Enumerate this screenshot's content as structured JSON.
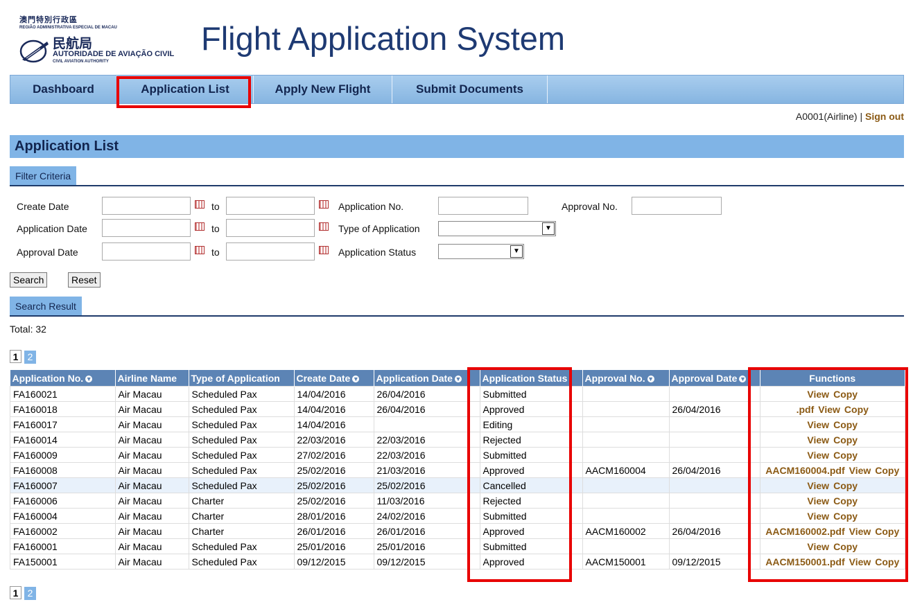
{
  "logo": {
    "cn_top": "澳門特別行政區",
    "pt_top": "REGIÃO ADMINISTRATIVA ESPECIAL DE MACAU",
    "cn_main": "民航局",
    "pt_main": "AUTORIDADE DE AVIAÇÃO CIVIL",
    "en_main": "CIVIL AVIATION AUTHORITY"
  },
  "title": "Flight Application System",
  "nav": [
    "Dashboard",
    "Application List",
    "Apply New Flight",
    "Submit Documents"
  ],
  "user": {
    "name": "A0001(Airline) |",
    "signout": "Sign out"
  },
  "section_title": "Application List",
  "filter": {
    "tab": "Filter Criteria",
    "create_date": "Create Date",
    "application_date": "Application Date",
    "approval_date": "Approval Date",
    "to": "to",
    "application_no": "Application No.",
    "type_of_application": "Type of Application",
    "application_status": "Application Status",
    "approval_no": "Approval No."
  },
  "buttons": {
    "search": "Search",
    "reset": "Reset"
  },
  "result": {
    "tab": "Search Result",
    "total": "Total: 32"
  },
  "pages": [
    "1",
    "2"
  ],
  "columns": [
    "Application No.",
    "Airline Name",
    "Type of Application",
    "Create Date",
    "Application Date",
    "Application Status",
    "Approval No.",
    "Approval Date",
    "Functions"
  ],
  "rows": [
    {
      "app": "FA160021",
      "airline": "Air Macau",
      "type": "Scheduled Pax",
      "create": "14/04/2016",
      "appdate": "26/04/2016",
      "status": "Submitted",
      "apprno": "",
      "apprdate": "",
      "pdf": ""
    },
    {
      "app": "FA160018",
      "airline": "Air Macau",
      "type": "Scheduled Pax",
      "create": "14/04/2016",
      "appdate": "26/04/2016",
      "status": "Approved",
      "apprno": "",
      "apprdate": "26/04/2016",
      "pdf": ".pdf"
    },
    {
      "app": "FA160017",
      "airline": "Air Macau",
      "type": "Scheduled Pax",
      "create": "14/04/2016",
      "appdate": "",
      "status": "Editing",
      "apprno": "",
      "apprdate": "",
      "pdf": ""
    },
    {
      "app": "FA160014",
      "airline": "Air Macau",
      "type": "Scheduled Pax",
      "create": "22/03/2016",
      "appdate": "22/03/2016",
      "status": "Rejected",
      "apprno": "",
      "apprdate": "",
      "pdf": ""
    },
    {
      "app": "FA160009",
      "airline": "Air Macau",
      "type": "Scheduled Pax",
      "create": "27/02/2016",
      "appdate": "22/03/2016",
      "status": "Submitted",
      "apprno": "",
      "apprdate": "",
      "pdf": ""
    },
    {
      "app": "FA160008",
      "airline": "Air Macau",
      "type": "Scheduled Pax",
      "create": "25/02/2016",
      "appdate": "21/03/2016",
      "status": "Approved",
      "apprno": "AACM160004",
      "apprdate": "26/04/2016",
      "pdf": "AACM160004.pdf"
    },
    {
      "app": "FA160007",
      "airline": "Air Macau",
      "type": "Scheduled Pax",
      "create": "25/02/2016",
      "appdate": "25/02/2016",
      "status": "Cancelled",
      "apprno": "",
      "apprdate": "",
      "pdf": ""
    },
    {
      "app": "FA160006",
      "airline": "Air Macau",
      "type": "Charter",
      "create": "25/02/2016",
      "appdate": "11/03/2016",
      "status": "Rejected",
      "apprno": "",
      "apprdate": "",
      "pdf": ""
    },
    {
      "app": "FA160004",
      "airline": "Air Macau",
      "type": "Charter",
      "create": "28/01/2016",
      "appdate": "24/02/2016",
      "status": "Submitted",
      "apprno": "",
      "apprdate": "",
      "pdf": ""
    },
    {
      "app": "FA160002",
      "airline": "Air Macau",
      "type": "Charter",
      "create": "26/01/2016",
      "appdate": "26/01/2016",
      "status": "Approved",
      "apprno": "AACM160002",
      "apprdate": "26/04/2016",
      "pdf": "AACM160002.pdf"
    },
    {
      "app": "FA160001",
      "airline": "Air Macau",
      "type": "Scheduled Pax",
      "create": "25/01/2016",
      "appdate": "25/01/2016",
      "status": "Submitted",
      "apprno": "",
      "apprdate": "",
      "pdf": ""
    },
    {
      "app": "FA150001",
      "airline": "Air Macau",
      "type": "Scheduled Pax",
      "create": "09/12/2015",
      "appdate": "09/12/2015",
      "status": "Approved",
      "apprno": "AACM150001",
      "apprdate": "09/12/2015",
      "pdf": "AACM150001.pdf"
    }
  ],
  "functions": {
    "view": "View",
    "copy": "Copy"
  },
  "colors": {
    "nav": "#86b5e1",
    "header_row": "#5c84b5",
    "link": "#8b5a14",
    "highlight": "#e80000"
  }
}
